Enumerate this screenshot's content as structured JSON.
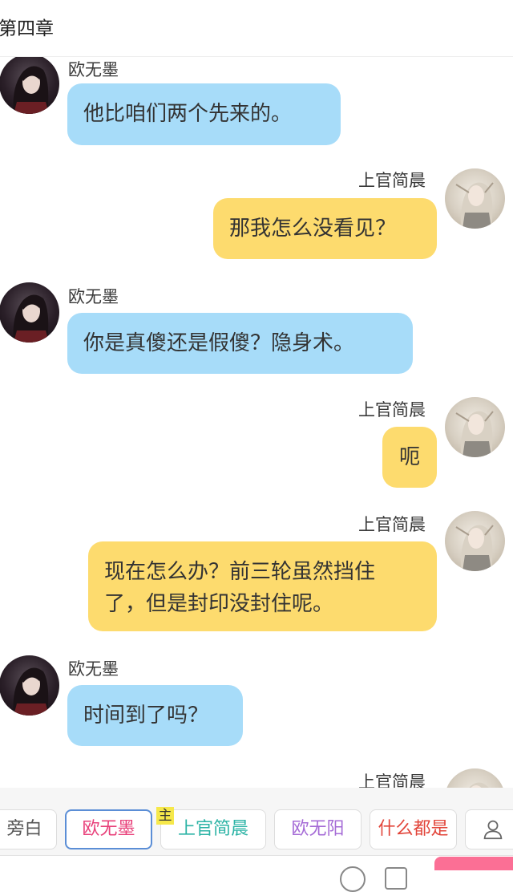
{
  "header": {
    "title": "第四章"
  },
  "messages": [
    {
      "speaker": "欧无墨",
      "text": "他比咱们两个先来的。",
      "side": "left",
      "color": "#a7dcf9"
    },
    {
      "speaker": "上官简晨",
      "text": "那我怎么没看见？",
      "side": "right",
      "color": "#fddb6e"
    },
    {
      "speaker": "欧无墨",
      "text": "你是真傻还是假傻？隐身术。",
      "side": "left",
      "color": "#a7dcf9"
    },
    {
      "speaker": "上官简晨",
      "text": "呃",
      "side": "right",
      "color": "#fddb6e"
    },
    {
      "speaker": "上官简晨",
      "text_line1": "现在怎么办？前三轮虽然挡住",
      "text_line2": "了，但是封印没封住呢。",
      "side": "right",
      "color": "#fddb6e"
    },
    {
      "speaker": "欧无墨",
      "text": "时间到了吗？",
      "side": "left",
      "color": "#a7dcf9"
    },
    {
      "speaker": "上官简晨",
      "side": "right"
    }
  ],
  "character_bar": {
    "chips": [
      {
        "label": "旁白",
        "color": "#555555"
      },
      {
        "label": "欧无墨",
        "color": "#e8407a",
        "selected": true
      },
      {
        "label": "上官简晨",
        "color": "#2bb3a5",
        "badge": "主"
      },
      {
        "label": "欧无阳",
        "color": "#a56bd6"
      },
      {
        "label": "什么都是",
        "color": "#e2453a"
      }
    ],
    "person_icon": "person-icon"
  },
  "colors": {
    "left_bubble": "#a7dcf9",
    "right_bubble": "#fddb6e",
    "send_button": "#fb6f95",
    "selected_border": "#5b8ed6"
  }
}
